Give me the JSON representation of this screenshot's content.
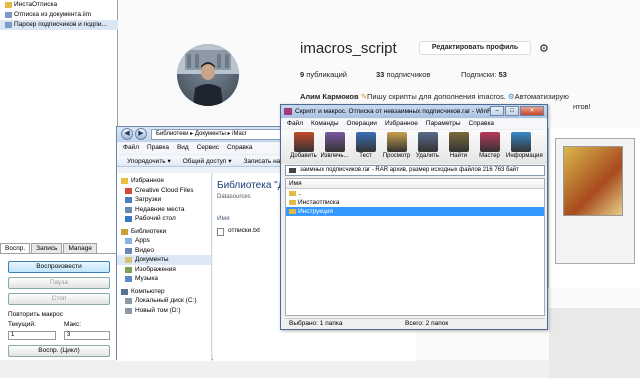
{
  "imacros": {
    "tree": [
      {
        "label": "ИнстаОтписка",
        "selected": false
      },
      {
        "label": "Отписка из документа.iim",
        "selected": false
      },
      {
        "label": "Парсер подписчиков и подпи...",
        "selected": true
      }
    ],
    "tabs": [
      "Воспр.",
      "Запись",
      "Manage"
    ],
    "active_tab": "Воспр.",
    "play_button": "Воспроизвести",
    "pause_button": "Пауза",
    "stop_button": "Стоп",
    "repeat_label": "Повторить макрос",
    "current_label": "Текущий:",
    "current_value": "1",
    "max_label": "Макс:",
    "max_value": "3",
    "loop_button": "Воспр. (Цикл)"
  },
  "instagram": {
    "username": "imacros_script",
    "edit_profile": "Редактировать профиль",
    "posts_count": "9",
    "posts_label": "публикаций",
    "followers_count": "33",
    "followers_label": "подписчиков",
    "following_label": "Подписки:",
    "following_count": "53",
    "full_name": "Алим Кармоков",
    "bio": "Пишу скрипты для дополнения imacros.",
    "bio_tail": "Автоматизирую",
    "bio_line2": "нтов!"
  },
  "explorer": {
    "address": "Библиотеки ▸ Документы ▸ iMacr",
    "menu": [
      "Файл",
      "Правка",
      "Вид",
      "Сервис",
      "Справка"
    ],
    "toolbar": [
      "Упорядочить ▾",
      "Общий доступ ▾",
      "Записать на"
    ],
    "nav": [
      {
        "label": "Избранное",
        "top": true,
        "color": "#e8c040"
      },
      {
        "label": "Creative Cloud Files",
        "top": false,
        "color": "#d04a3a"
      },
      {
        "label": "Загрузки",
        "top": false,
        "color": "#4a7cc0"
      },
      {
        "label": "Недавние места",
        "top": false,
        "color": "#6a8ab0"
      },
      {
        "label": "Рабочий стол",
        "top": false,
        "color": "#3c78c0"
      },
      {
        "label": "Библиотеки",
        "top": true,
        "color": "#c9a23e"
      },
      {
        "label": "Apps",
        "top": false,
        "color": "#8bb3de"
      },
      {
        "label": "Видео",
        "top": false,
        "color": "#6a8ab0"
      },
      {
        "label": "Документы",
        "top": false,
        "color": "#d8c27a",
        "selected": true
      },
      {
        "label": "Изображения",
        "top": false,
        "color": "#7aa05a"
      },
      {
        "label": "Музыка",
        "top": false,
        "color": "#5a88c8"
      },
      {
        "label": "Компьютер",
        "top": true,
        "color": "#5b7390"
      },
      {
        "label": "Локальный диск (C:)",
        "top": false,
        "color": "#8898a8"
      },
      {
        "label": "Новый том (D:)",
        "top": false,
        "color": "#8898a8"
      }
    ],
    "library_title": "Библиотека \"Д",
    "library_sub": "Datasources",
    "column_name": "Имя",
    "file": "отписки.txt"
  },
  "winrar": {
    "title": "Скрипт и макрос. Отписка от невзаимных подписчиков.rar - WinRAR",
    "menu": [
      "Файл",
      "Команды",
      "Операции",
      "Избранное",
      "Параметры",
      "Справка"
    ],
    "tools": [
      {
        "label": "Добавить",
        "color": "#c04a2a"
      },
      {
        "label": "Извлечь...",
        "color": "#7a5aa0"
      },
      {
        "label": "Тест",
        "color": "#3a70b8"
      },
      {
        "label": "Просмотр",
        "color": "#c8a04a"
      },
      {
        "label": "Удалить",
        "color": "#5a6a8a"
      },
      {
        "label": "Найти",
        "color": "#7a6a3a"
      },
      {
        "label": "Мастер",
        "color": "#b83a5a"
      },
      {
        "label": "Информация",
        "color": "#3a8ac8"
      }
    ],
    "path": "заимных подписчиков.rar - RAR архив, размер исходных файлов 216 763 байт",
    "column_name": "Имя",
    "rows": [
      {
        "label": "..",
        "selected": false
      },
      {
        "label": "Инстаотписка",
        "selected": false
      },
      {
        "label": "Инструкция",
        "selected": true
      }
    ],
    "status_left": "Выбрано: 1 папка",
    "status_right": "Всего: 2 папок"
  }
}
